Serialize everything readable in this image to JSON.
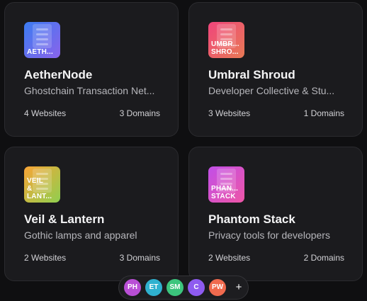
{
  "projects": [
    {
      "logo_text": "AETH...",
      "logo_gradient": [
        "#3b7cf2",
        "#8a63ea"
      ],
      "name": "AetherNode",
      "description": "Ghostchain Transaction Net...",
      "websites": "4 Websites",
      "domains": "3 Domains"
    },
    {
      "logo_text": "UMBR...\nSHRO...",
      "logo_gradient": [
        "#f0457c",
        "#e87a55"
      ],
      "name": "Umbral Shroud",
      "description": "Developer Collective & Stu...",
      "websites": "3 Websites",
      "domains": "1 Domains"
    },
    {
      "logo_text": "VEIL\n&\nLANT...",
      "logo_gradient": [
        "#f9a436",
        "#8fcf4f"
      ],
      "name": "Veil & Lantern",
      "description": "Gothic lamps and apparel",
      "websites": "2 Websites",
      "domains": "3 Domains"
    },
    {
      "logo_text": "PHAN...\nSTACK",
      "logo_gradient": [
        "#c14fe8",
        "#ee56a6"
      ],
      "name": "Phantom Stack",
      "description": "Privacy tools for developers",
      "websites": "2 Websites",
      "domains": "2 Domains"
    }
  ],
  "members": [
    {
      "initials": "PH",
      "color": "#b94fd6"
    },
    {
      "initials": "ET",
      "color": "#2fb1cf"
    },
    {
      "initials": "SM",
      "color": "#3cc57d"
    },
    {
      "initials": "C",
      "color": "#8e5bf0"
    },
    {
      "initials": "PW",
      "color": "#f06a4e"
    }
  ],
  "add_member_icon": "plus-icon",
  "add_member_label": "+"
}
